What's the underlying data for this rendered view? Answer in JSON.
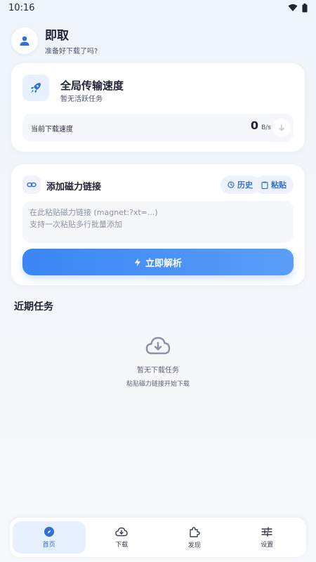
{
  "statusbar": {
    "time": "10:16"
  },
  "header": {
    "title": "即取",
    "subtitle": "准备好下载了吗?"
  },
  "speed_card": {
    "title": "全局传输速度",
    "subtitle": "暂无活跃任务",
    "current_label": "当前下载速度",
    "value": "0",
    "unit": "B/s"
  },
  "magnet_card": {
    "title": "添加磁力链接",
    "history_label": "历史",
    "paste_label": "粘贴",
    "placeholder_line1": "在此粘贴磁力链接 (magnet:?xt=...)",
    "placeholder_line2": "支持一次粘贴多行批量添加",
    "parse_label": "立即解析"
  },
  "recent": {
    "title": "近期任务",
    "empty_title": "暂无下载任务",
    "empty_sub": "粘贴磁力链接开始下载"
  },
  "nav": {
    "items": [
      {
        "label": "首页",
        "icon": "compass-icon",
        "active": true
      },
      {
        "label": "下载",
        "icon": "cloud-download-icon",
        "active": false
      },
      {
        "label": "发现",
        "icon": "puzzle-icon",
        "active": false
      },
      {
        "label": "设置",
        "icon": "sliders-icon",
        "active": false
      }
    ]
  },
  "colors": {
    "accent": "#3a86f5",
    "accent_dark": "#2f6fd6",
    "background": "#eef4fb"
  }
}
